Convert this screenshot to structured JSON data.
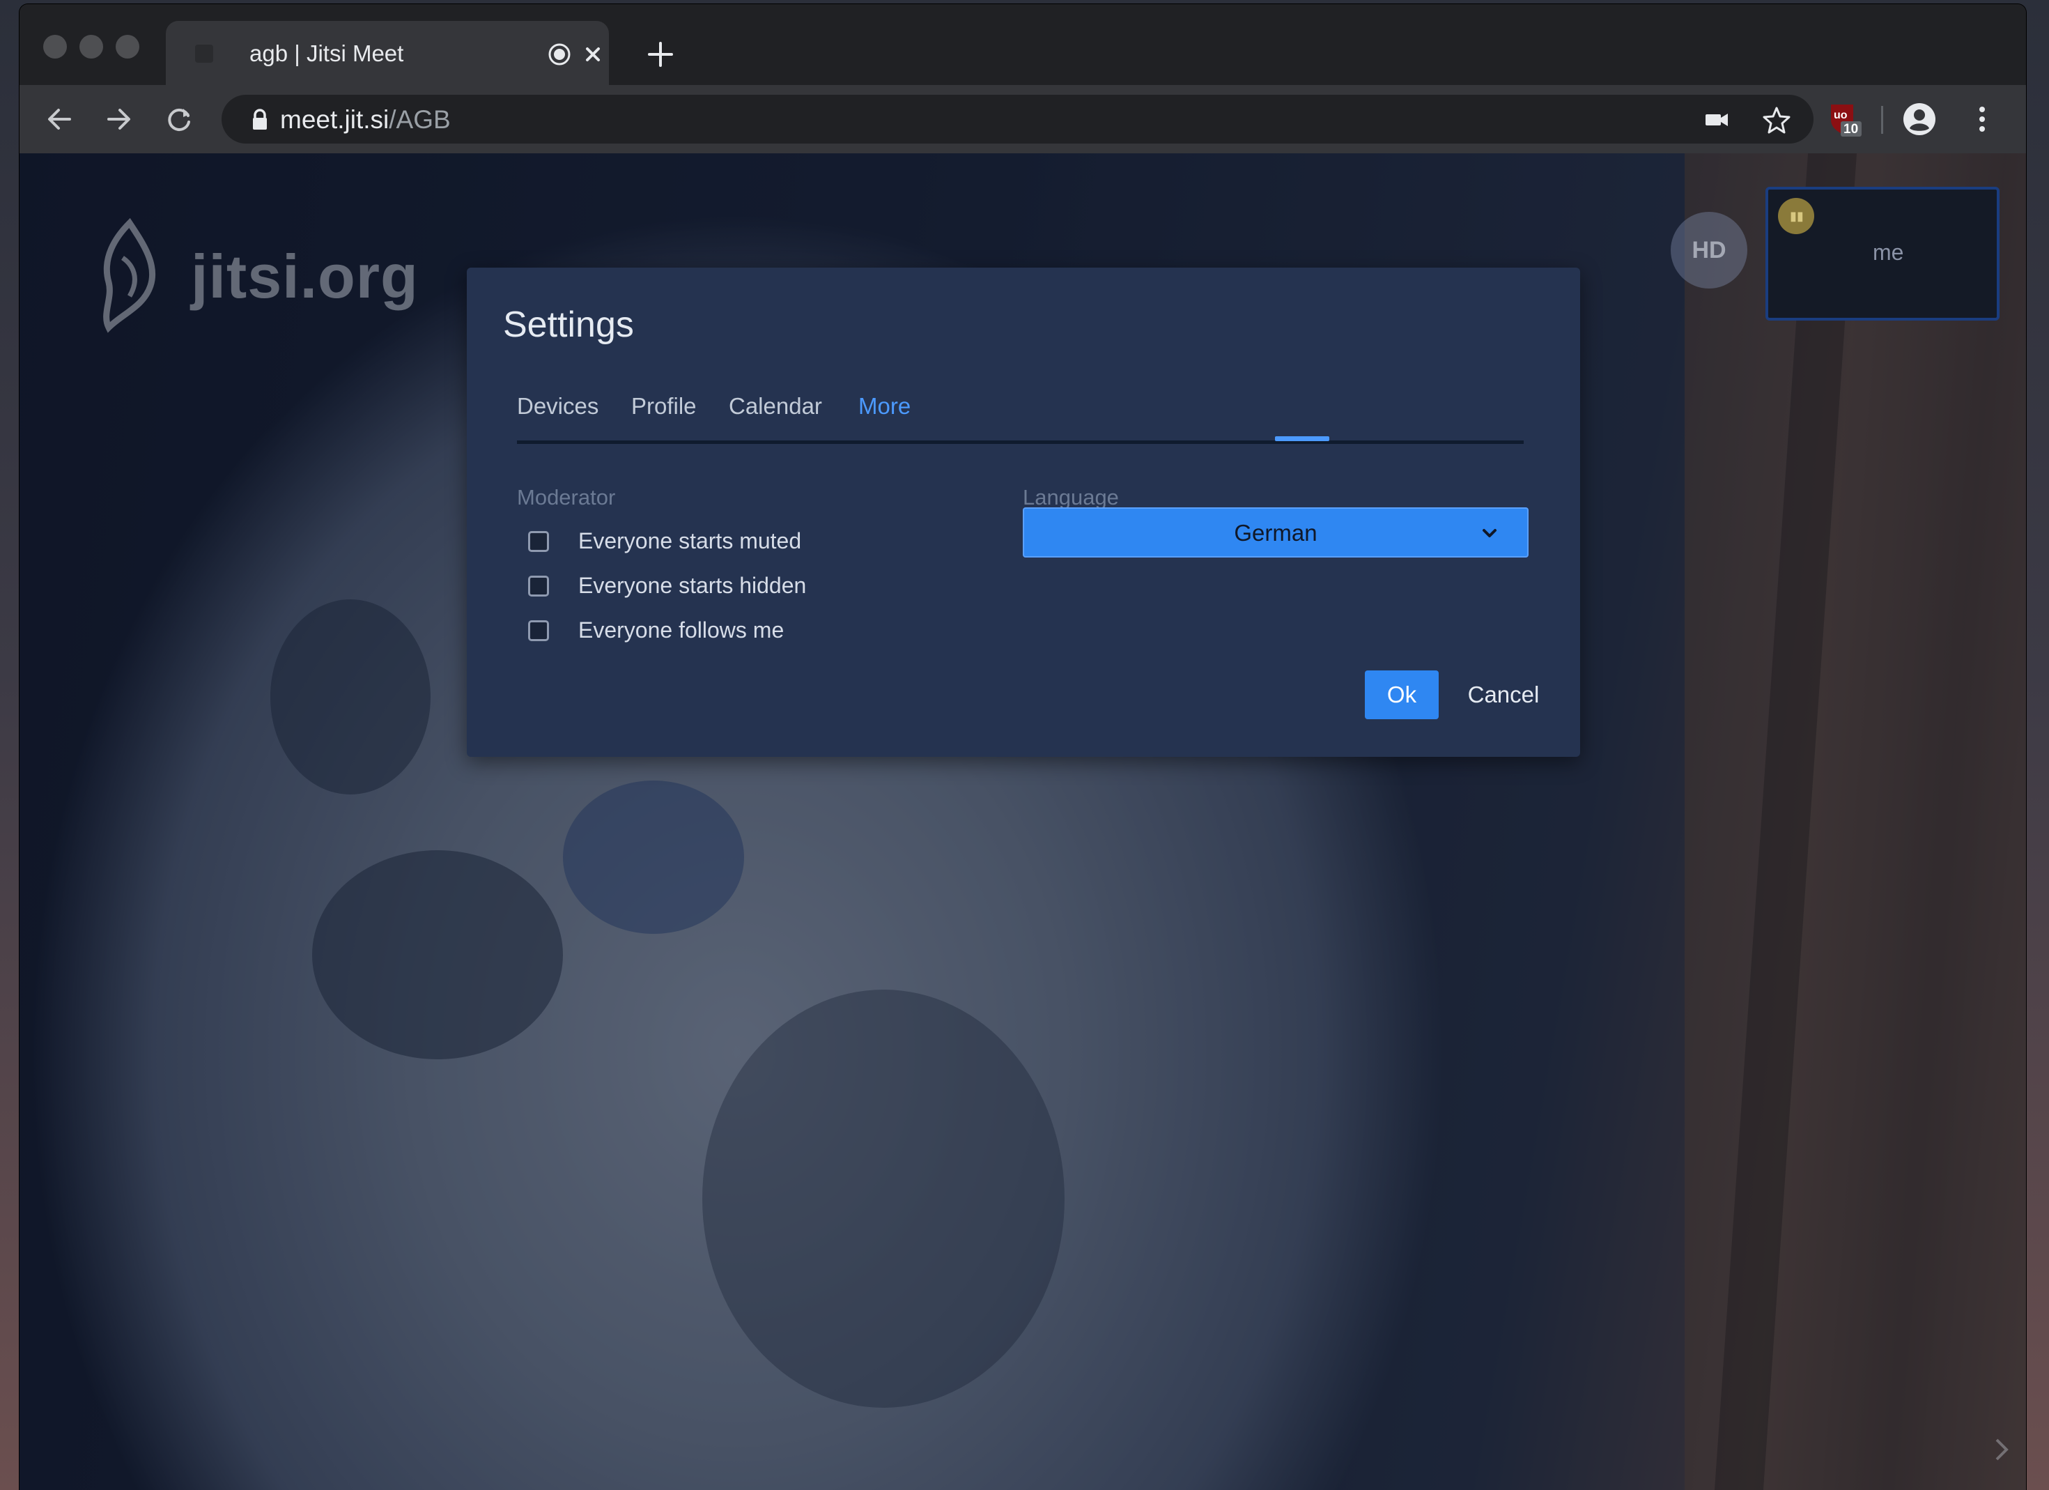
{
  "browser": {
    "tab": {
      "title": "agb | Jitsi Meet"
    },
    "url": {
      "host": "meet.jit.si",
      "path": "/AGB"
    },
    "extension_badge": "10"
  },
  "page": {
    "logo_text": "jitsi.org",
    "quality_badge": "HD",
    "local_video_name": "me"
  },
  "settings_dialog": {
    "title": "Settings",
    "tabs": [
      {
        "label": "Devices"
      },
      {
        "label": "Profile"
      },
      {
        "label": "Calendar"
      },
      {
        "label": "More",
        "active": true
      }
    ],
    "moderator": {
      "label": "Moderator",
      "options": [
        {
          "label": "Everyone starts muted",
          "checked": false
        },
        {
          "label": "Everyone starts hidden",
          "checked": false
        },
        {
          "label": "Everyone follows me",
          "checked": false
        }
      ]
    },
    "language": {
      "label": "Language",
      "selected": "German"
    },
    "ok_label": "Ok",
    "cancel_label": "Cancel"
  },
  "colors": {
    "accent": "#2f87f2",
    "dialog_bg": "#253350",
    "active_tab": "#4c9aff"
  }
}
